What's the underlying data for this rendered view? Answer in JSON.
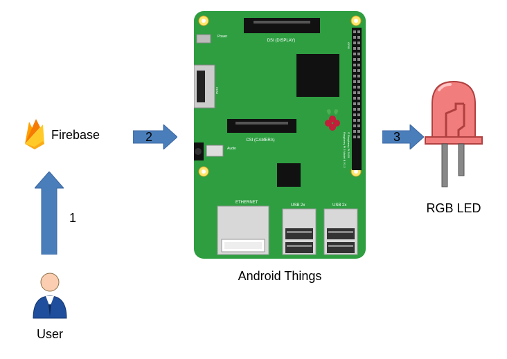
{
  "diagram": {
    "nodes": {
      "user": {
        "label": "User"
      },
      "firebase": {
        "label": "Firebase"
      },
      "android_things": {
        "label": "Android Things"
      },
      "rgb_led": {
        "label": "RGB LED"
      }
    },
    "arrows": {
      "a1": {
        "number": "1",
        "from": "user",
        "to": "firebase"
      },
      "a2": {
        "number": "2",
        "from": "firebase",
        "to": "android_things"
      },
      "a3": {
        "number": "3",
        "from": "android_things",
        "to": "rgb_led"
      }
    }
  }
}
